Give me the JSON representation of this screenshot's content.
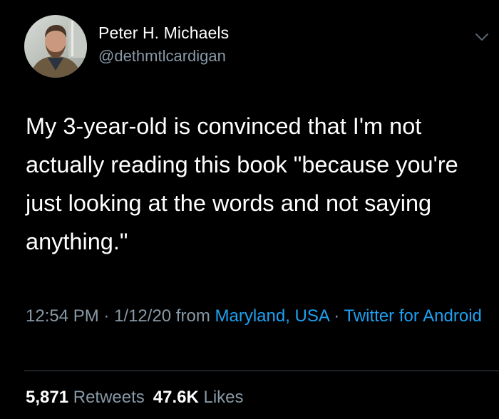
{
  "author": {
    "name": "Peter H. Michaels",
    "handle": "@dethmtlcardigan"
  },
  "tweet": {
    "text": "My 3-year-old is convinced that I'm not actually reading this book \"because you're just looking at the words and not saying anything.\""
  },
  "meta": {
    "time": "12:54 PM",
    "separator": " · ",
    "date": "1/12/20",
    "from_label": " from ",
    "location": "Maryland, USA",
    "source": "Twitter for Android"
  },
  "stats": {
    "retweets_count": "5,871",
    "retweets_label": "Retweets",
    "likes_count": "47.6K",
    "likes_label": "Likes"
  },
  "colors": {
    "background": "#000000",
    "text": "#ffffff",
    "secondary": "#8899a6",
    "link": "#1da1f2",
    "divider": "#38444d"
  },
  "icons": {
    "menu": "chevron-down-icon"
  }
}
